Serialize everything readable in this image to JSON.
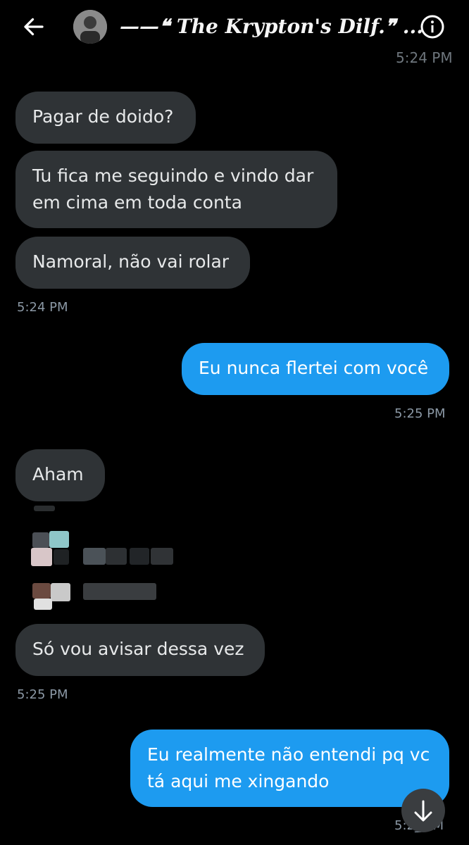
{
  "header": {
    "title": "——❝ The Krypton's Dilf.❞ ...",
    "back_icon": "arrow-left-icon",
    "info_icon": "info-icon"
  },
  "messages": {
    "ts_top": "5:24 PM",
    "m1": "Pagar de doido?",
    "m2_line1": "Tu fica me seguindo e vindo dar",
    "m2_line2": "em cima em toda conta",
    "m3": "Namoral, não vai rolar",
    "ts1": "5:24 PM",
    "m4": "Eu nunca flertei com você",
    "ts2": "5:25 PM",
    "m5": "Aham",
    "m6": "Só vou avisar dessa vez",
    "ts3": "5:25 PM",
    "m7_line1": "Eu realmente não entendi pq vc",
    "m7_line2": "tá aqui me xingando",
    "ts4": "5:2_ PM"
  },
  "colors": {
    "incoming_bubble": "#2f3336",
    "outgoing_bubble": "#1d9bf0",
    "background": "#000000"
  },
  "scroll_button_icon": "arrow-down-icon"
}
